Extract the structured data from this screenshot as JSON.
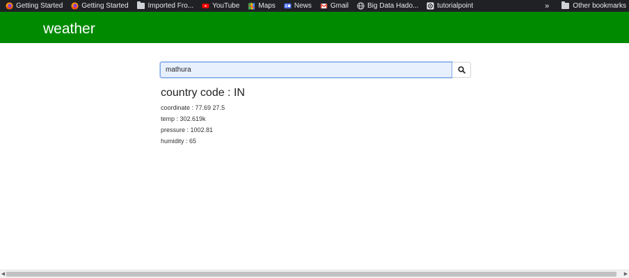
{
  "bookmarks": [
    {
      "label": "Getting Started",
      "icon": "firefox-icon"
    },
    {
      "label": "Getting Started",
      "icon": "firefox-icon"
    },
    {
      "label": "Imported Fro...",
      "icon": "folder-icon"
    },
    {
      "label": "YouTube",
      "icon": "youtube-icon"
    },
    {
      "label": "Maps",
      "icon": "maps-icon"
    },
    {
      "label": "News",
      "icon": "news-icon"
    },
    {
      "label": "Gmail",
      "icon": "gmail-icon"
    },
    {
      "label": "Big Data Hado...",
      "icon": "globe-icon"
    },
    {
      "label": "tutorialpoint",
      "icon": "tutorialpoint-icon"
    }
  ],
  "bookmarks_overflow": "»",
  "other_bookmarks": "Other bookmarks",
  "header": {
    "title": "weather",
    "bg_color": "#008a00"
  },
  "search": {
    "value": "mathura",
    "button_icon": "search-icon"
  },
  "result": {
    "country": "country code : IN",
    "coordinate": "coordinate : 77.69 27.5",
    "temp": "temp : 302.619k",
    "pressure": "pressure : 1002.81",
    "humidity": "humidity : 65"
  }
}
